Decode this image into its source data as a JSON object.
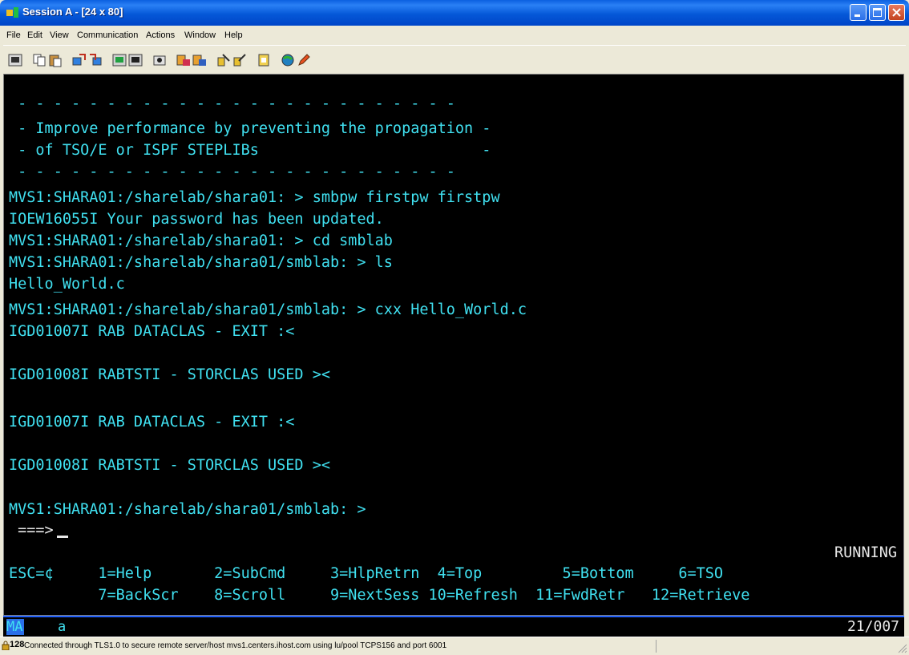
{
  "window": {
    "title": "Session A - [24 x 80]",
    "controls": [
      "minimize",
      "maximize",
      "close"
    ]
  },
  "menu": {
    "items": [
      "File",
      "Edit",
      "View",
      "Communication",
      "Actions",
      "Window",
      "Help"
    ]
  },
  "toolbar": {
    "icons": [
      "print-screen-icon",
      "copy-icon",
      "paste-icon",
      "send-file-icon",
      "receive-file-icon",
      "display-setup-icon",
      "keyboard-map-icon",
      "record-macro-icon",
      "play-macro-icon",
      "stop-macro-icon",
      "customize-icon",
      "connection-icon",
      "help-icon",
      "edit-icon",
      "web-icon",
      "pencil-icon"
    ]
  },
  "terminal": {
    "lines": [
      " - - - - - - - - - - - - - - - - - - - - - - - - -",
      " - Improve performance by preventing the propagation -",
      " - of TSO/E or ISPF STEPLIBs                         -",
      " - - - - - - - - - - - - - - - - - - - - - - - - -",
      "MVS1:SHARA01:/sharelab/shara01: > smbpw firstpw firstpw",
      "IOEW16055I Your password has been updated.",
      "MVS1:SHARA01:/sharelab/shara01: > cd smblab",
      "MVS1:SHARA01:/sharelab/shara01/smblab: > ls",
      "Hello_World.c",
      "MVS1:SHARA01:/sharelab/shara01/smblab: > cxx Hello_World.c",
      "IGD01007I RAB DATACLAS - EXIT :<",
      "",
      "IGD01008I RABTSTI - STORCLAS USED ><",
      "",
      "IGD01007I RAB DATACLAS - EXIT :<",
      "",
      "IGD01008I RABTSTI - STORCLAS USED ><",
      "",
      "MVS1:SHARA01:/sharelab/shara01/smblab: >"
    ],
    "prompt": " ===>",
    "status": "RUNNING",
    "pf_row1": "ESC=¢     1=Help       2=SubCmd     3=HlpRetrn  4=Top         5=Bottom     6=TSO",
    "pf_row2": "          7=BackScr    8=Scroll     9=NextSess 10=Refresh  11=FwdRetr   12=Retrieve"
  },
  "oia": {
    "indicator": "MA",
    "mode": "a",
    "cursor_position": "21/007"
  },
  "status_bar": {
    "number": "128",
    "text": "Connected through TLS1.0 to secure remote server/host mvs1.centers.ihost.com using lu/pool TCPS156 and port 6001"
  }
}
